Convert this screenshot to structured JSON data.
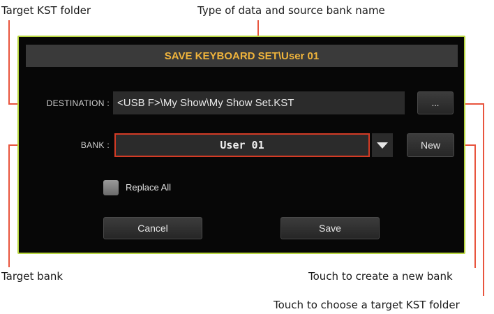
{
  "annotations": {
    "target_kst_folder": "Target KST folder",
    "type_of_data": "Type of data and source bank name",
    "target_bank": "Target bank",
    "create_new_bank": "Touch to create a new bank",
    "choose_kst_folder": "Touch to choose a target KST folder"
  },
  "dialog": {
    "title": "SAVE KEYBOARD SET\\User 01",
    "destination_label": "DESTINATION :",
    "destination_value": "<USB F>\\My Show\\My Show Set.KST",
    "browse_label": "...",
    "bank_label": "BANK :",
    "bank_value": "User 01",
    "new_label": "New",
    "replace_all_label": "Replace All",
    "cancel_label": "Cancel",
    "save_label": "Save"
  },
  "colors": {
    "dialog_border": "#b8d640",
    "title_text": "#f0b43c",
    "callout_line": "#e8553e",
    "bank_field_border": "#d33b25"
  }
}
